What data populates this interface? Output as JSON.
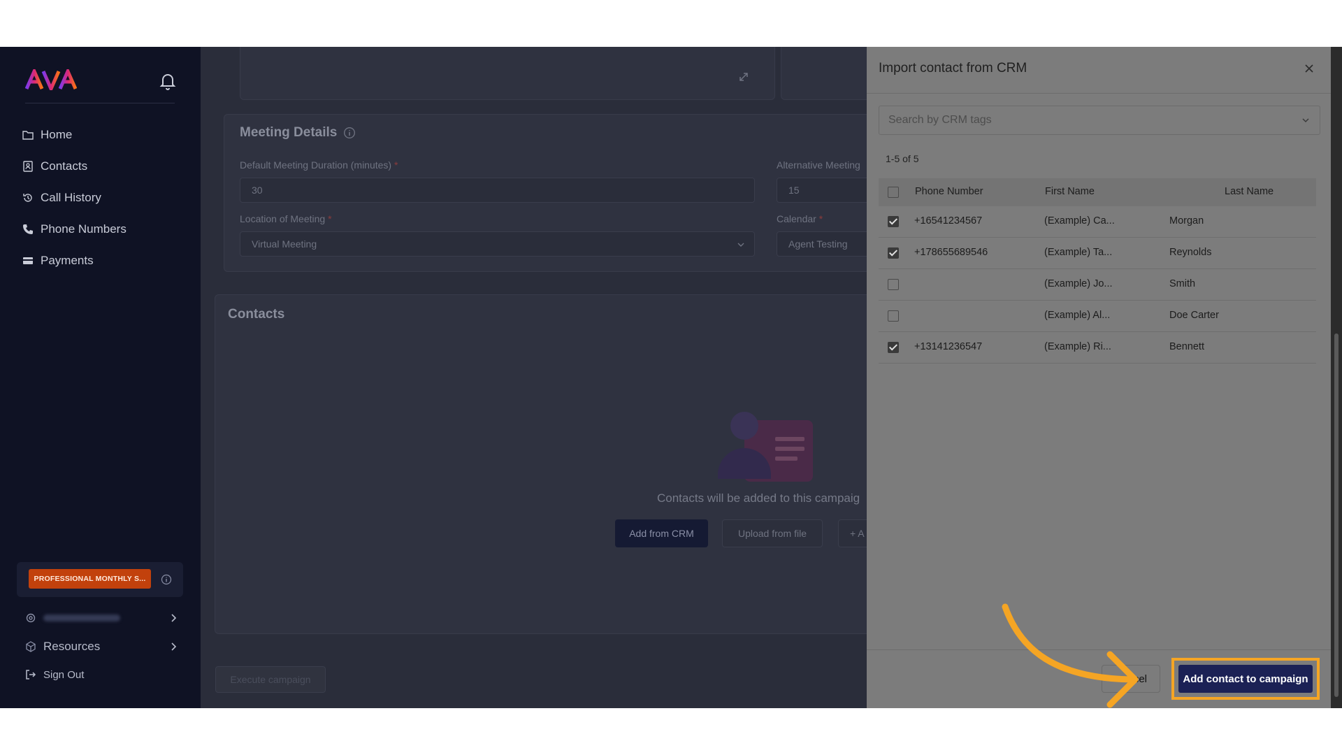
{
  "sidebar": {
    "brand": "AVA",
    "nav": [
      {
        "label": "Home",
        "icon": "folder-icon"
      },
      {
        "label": "Contacts",
        "icon": "contact-card-icon"
      },
      {
        "label": "Call History",
        "icon": "history-icon"
      },
      {
        "label": "Phone Numbers",
        "icon": "phone-icon"
      },
      {
        "label": "Payments",
        "icon": "credit-card-icon"
      }
    ],
    "plan_badge": "PROFESSIONAL MONTHLY S...",
    "resources": "Resources",
    "sign_out": "Sign Out"
  },
  "main": {
    "meeting_title": "Meeting Details",
    "duration_label": "Default Meeting Duration (minutes)",
    "duration_value": "30",
    "alt_label": "Alternative Meeting",
    "alt_value": "15",
    "location_label": "Location of Meeting",
    "location_value": "Virtual Meeting",
    "calendar_label": "Calendar",
    "calendar_value": "Agent Testing",
    "required_mark": "*",
    "contacts_title": "Contacts",
    "empty_text": "Contacts will be added to this campaig",
    "add_from_crm": "Add from CRM",
    "upload_from_file": "Upload from file",
    "add_manual": "+ A",
    "execute": "Execute campaign"
  },
  "modal": {
    "title": "Import contact from CRM",
    "search_placeholder": "Search by CRM tags",
    "count": "1-5 of 5",
    "columns": [
      "Phone Number",
      "First Name",
      "Last Name"
    ],
    "rows": [
      {
        "checked": true,
        "phone": "+16541234567",
        "first": "(Example) Ca...",
        "last": "Morgan"
      },
      {
        "checked": true,
        "phone": "+178655689546",
        "first": "(Example) Ta...",
        "last": "Reynolds"
      },
      {
        "checked": false,
        "phone": "",
        "first": "(Example) Jo...",
        "last": "Smith"
      },
      {
        "checked": false,
        "phone": "",
        "first": "(Example) Al...",
        "last": "Doe Carter"
      },
      {
        "checked": true,
        "phone": "+13141236547",
        "first": "(Example) Ri...",
        "last": "Bennett"
      }
    ],
    "cancel": "cel",
    "add_button": "Add contact to campaign"
  },
  "colors": {
    "highlight": "#f5a524",
    "primary_button": "#1b2155",
    "plan_badge": "#c2410c"
  }
}
